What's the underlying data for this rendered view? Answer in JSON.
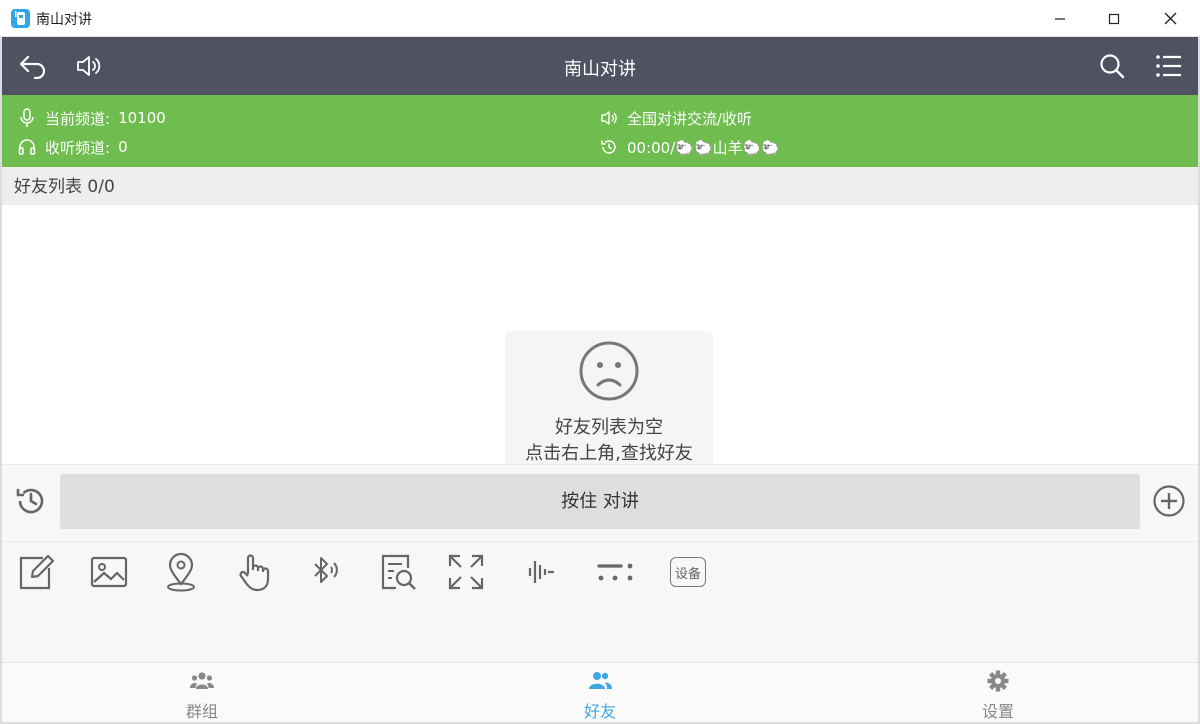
{
  "window": {
    "title": "南山对讲"
  },
  "appbar": {
    "title": "南山对讲"
  },
  "status": {
    "current_channel_label": "当前频道:",
    "current_channel_value": "10100",
    "listen_channel_label": "收听频道:",
    "listen_channel_value": "0",
    "broadcast_text": "全国对讲交流/收听",
    "timer_text": "00:00/🐑🐑山羊🐑🐑"
  },
  "list_header": {
    "title": "好友列表 0/0"
  },
  "empty_state": {
    "line1": "好友列表为空",
    "line2": "点击右上角,查找好友"
  },
  "talk": {
    "ptt_label": "按住 对讲"
  },
  "toolbar": {
    "device_label": "设备"
  },
  "nav": {
    "items": [
      {
        "label": "群组",
        "color": "#888888"
      },
      {
        "label": "好友",
        "color": "#3ea8e5"
      },
      {
        "label": "设置",
        "color": "#888888"
      }
    ]
  },
  "colors": {
    "appbar": "#4f5260",
    "status_bar": "#6fbd4f",
    "accent": "#3ea8e5"
  }
}
